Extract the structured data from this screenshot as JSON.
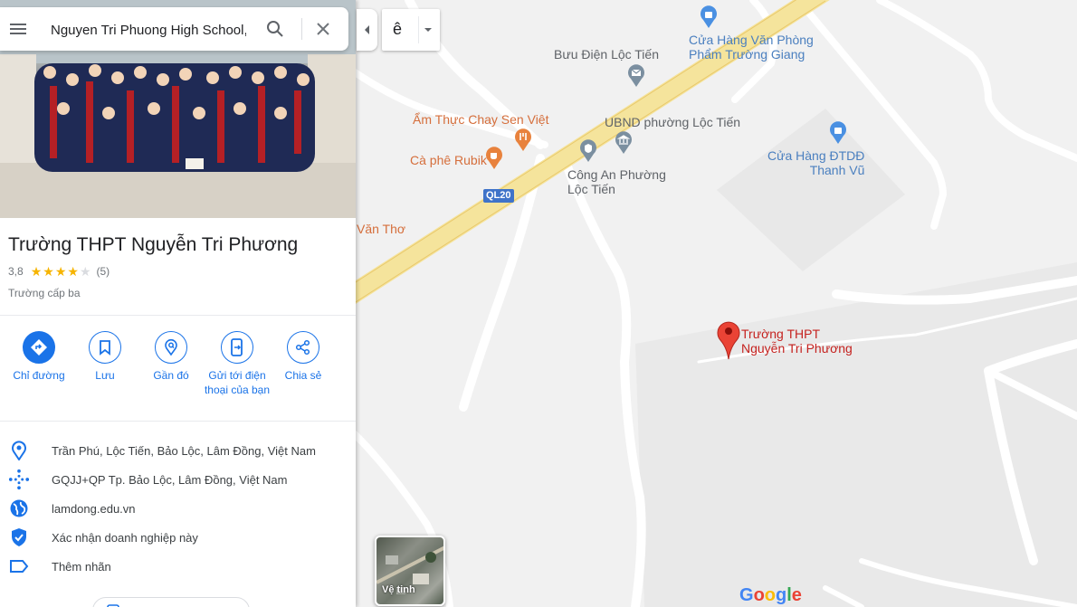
{
  "search": {
    "value": "Nguyen Tri Phuong High School, T"
  },
  "place": {
    "title": "Trường THPT Nguyễn Tri Phương",
    "rating": "3,8",
    "rating_value": 3.8,
    "reviews": "(5)",
    "category": "Trường cấp ba"
  },
  "actions": [
    {
      "label": "Chỉ đường",
      "icon": "directions-icon"
    },
    {
      "label": "Lưu",
      "icon": "bookmark-icon"
    },
    {
      "label": "Gần đó",
      "icon": "nearby-icon"
    },
    {
      "label": "Gửi tới điện thoại của bạn",
      "icon": "send-to-phone-icon"
    },
    {
      "label": "Chia sẻ",
      "icon": "share-icon"
    }
  ],
  "info": {
    "address": "Trần Phú, Lộc Tiến, Bảo Lộc, Lâm Đồng, Việt Nam",
    "plus_code": "GQJJ+QP Tp. Bảo Lộc, Lâm Đồng, Việt Nam",
    "website": "lamdong.edu.vn",
    "claim": "Xác nhận doanh nghiệp này",
    "label": "Thêm nhãn"
  },
  "map": {
    "language_char": "ê",
    "satellite_label": "Vệ tinh",
    "road_shield": "QL20",
    "labels": {
      "buu_dien": "Bưu Điện Lộc Tiến",
      "cua_hang_vp": "Cửa Hàng Văn Phòng\nPhẩm Trường Giang",
      "am_thuc": "Ẩm Thực Chay Sen Việt",
      "ubnd": "UBND phường Lộc Tiến",
      "ca_phe": "Cà phê Rubik",
      "cong_an": "Công An Phường\nLộc Tiến",
      "dtdd": "Cửa Hàng ĐTDĐ\nThanh Vũ",
      "van_tho": "Văn Thơ",
      "school": "Trường THPT\nNguyễn Tri Phương"
    },
    "google": [
      "G",
      "o",
      "o",
      "g",
      "l",
      "e"
    ]
  },
  "colors": {
    "accent": "#1a73e8",
    "pin_red": "#ea4335",
    "road_yellow": "#f5e49c",
    "poi_orange": "#e8823d",
    "poi_blue": "#4a90e2"
  }
}
